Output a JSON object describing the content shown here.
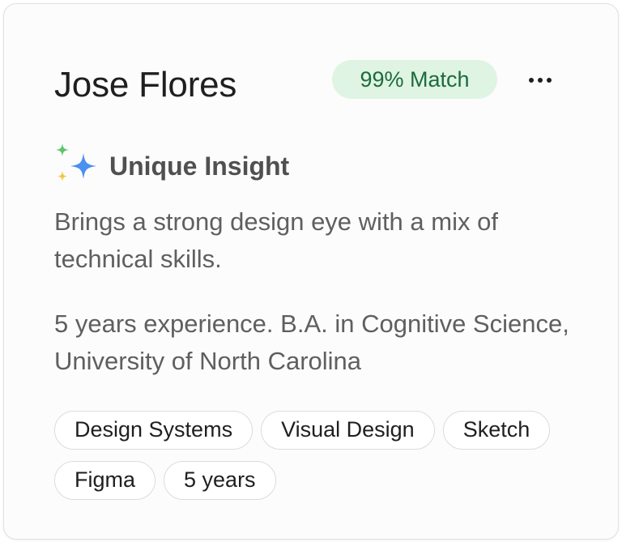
{
  "candidate": {
    "name": "Jose Flores",
    "match_label": "99% Match"
  },
  "menu": {
    "icon": "more-horizontal-icon"
  },
  "insight": {
    "icon": "sparkle-icon",
    "title": "Unique Insight",
    "text": "Brings a strong design eye with a mix of technical skills."
  },
  "experience": {
    "text": "5 years experience. B.A. in Cognitive Science, University of North Carolina"
  },
  "tags": [
    "Design Systems",
    "Visual Design",
    "Sketch",
    "Figma",
    "5 years"
  ],
  "colors": {
    "match_bg": "#dff4e3",
    "match_text": "#1e6b3c",
    "sparkle_blue": "#4a90f0",
    "sparkle_green": "#5cc46b",
    "sparkle_yellow": "#f2c744"
  }
}
